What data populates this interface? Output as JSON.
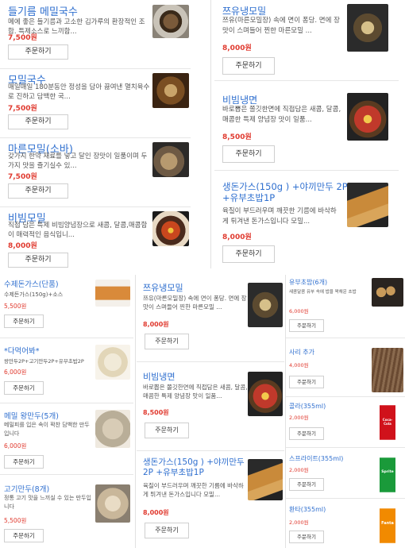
{
  "panel_top_left": [
    {
      "title": "들기름 메밀국수",
      "desc": "메에 좋은 들기름과 고소한 김가루의 환장적인 조합. 특제소스로 느끼함...",
      "price": "7,500원",
      "button": "주문하기"
    },
    {
      "title": "모밀국수",
      "desc": "매일매일 180분동안 정성을 담아 끓여낸 멸치육수로 진하고 담백한 국...",
      "price": "7,500원",
      "button": "주문하기"
    },
    {
      "title": "마른모밀(소바)",
      "desc": "갖가지 한약 재료를 넣고 달인 장맛이 일품이며 두가지 맛을 즐기실수 있...",
      "price": "7,500원",
      "button": "주문하기"
    },
    {
      "title": "비빔모밀",
      "desc": "직접 담은 특제 비빔양념장으로 새콤, 달콤,매콤함이 매력적인 음식입니...",
      "price": "8,000원",
      "button": "주문하기"
    }
  ],
  "panel_top_right": [
    {
      "title": "쯔유냉모밀",
      "desc": "쯔유(마른모밀장) 속에 면이 퐁당. 면에 장맛이 스며들어 찐한 마른모밀 ...",
      "price": "8,000원",
      "button": "주문하기"
    },
    {
      "title": "비빔냉면",
      "desc": "바로뽑은 쫄깃한면에 직접담은 새콤, 달콤,매콤한 특제 양념장 맛이 일품...",
      "price": "8,500원",
      "button": "주문하기"
    },
    {
      "title": "생돈가스(150g ) +야끼만두 2P +유부초밥1P",
      "desc": "육질이 부드러우며 깨끗한 기름에 바삭하게 튀겨낸 돈가스입니다 모밀...",
      "price": "8,000원",
      "button": "주문하기"
    }
  ],
  "panel_bottom_left": [
    {
      "title": "수제돈가스(단품)",
      "desc": "수제돈가스(150g)+소스",
      "price": "5,500원",
      "button": "주문하기"
    },
    {
      "title": "*다먹어봐*",
      "desc": "왕만두2P+고기만두2P+유부초밥2P",
      "price": "6,000원",
      "button": "주문하기"
    },
    {
      "title": "메밀 왕만두(5개)",
      "desc": "메밀피를 입은 속이 꽉찬 담백한 만두입니다",
      "price": "6,000원",
      "button": "주문하기"
    },
    {
      "title": "고기만두(8개)",
      "desc": "정통 고기 맛을 느끼실 수 있는 만두입니다",
      "price": "5,500원",
      "button": "주문하기"
    }
  ],
  "panel_bottom_mid": [
    {
      "title": "쯔유냉모밀",
      "desc": "쯔유(마른모밀장) 속에 면이 퐁당. 면에 장맛이 스며들어 찐한 마른모밀 ...",
      "price": "8,000원",
      "button": "주문하기"
    },
    {
      "title": "비빔냉면",
      "desc": "바로뽑은 쫄깃한면에 직접담은 새콤, 달콤,매콤한 특제 양념장 맛이 일품...",
      "price": "8,500원",
      "button": "주문하기"
    },
    {
      "title": "생돈가스(150g ) +야끼만두 2P +유부초밥1P",
      "desc": "육질이 부드러우며 깨끗한 기름에 바삭하게 튀겨낸 돈가스입니다 모밀...",
      "price": "8,000원",
      "button": "주문하기"
    }
  ],
  "panel_bottom_right": [
    {
      "title": "유부초밥(6개)",
      "desc": "새콤달콤 유부 속에 밥을 꽉채운 초밥",
      "price": "6,000원",
      "button": "주문하기"
    },
    {
      "title": "사리 추가",
      "desc": "",
      "price": "4,000원",
      "button": "주문하기"
    },
    {
      "title": "콜라(355ml)",
      "desc": "",
      "price": "2,000원",
      "button": "주문하기",
      "can": "Coca-Cola"
    },
    {
      "title": "스프라이트(355ml)",
      "desc": "",
      "price": "2,000원",
      "button": "주문하기",
      "can": "Sprite"
    },
    {
      "title": "환타(355ml)",
      "desc": "",
      "price": "2,000원",
      "button": "주문하기",
      "can": "Fanta"
    }
  ]
}
